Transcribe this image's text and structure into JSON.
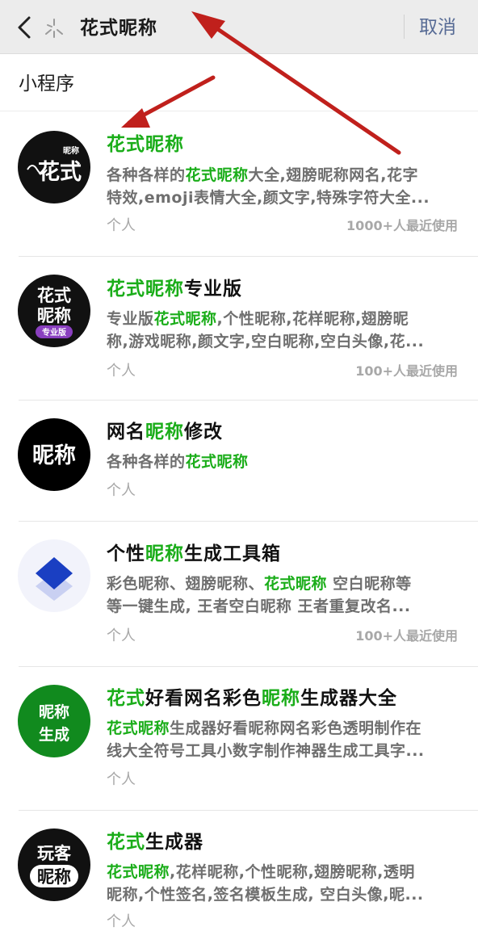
{
  "search": {
    "query": "花式昵称",
    "cancel_label": "取消"
  },
  "section_title": "小程序",
  "results": [
    {
      "title": [
        {
          "t": "花式昵称",
          "hl": true
        }
      ],
      "desc_lines": [
        [
          {
            "t": "各种各样的",
            "hl": false
          },
          {
            "t": "花式昵称",
            "hl": true
          },
          {
            "t": "大全,翅膀昵称网名,花字",
            "hl": false
          }
        ],
        [
          {
            "t": "特效,emoji表情大全,颜文字,特殊字符大全...",
            "hl": false
          }
        ]
      ],
      "type": "个人",
      "usage": "1000+人最近使用",
      "icon": {
        "name": "huashi-logo-icon",
        "text_main": "花式",
        "text_small": "昵称",
        "bg": "#111111"
      }
    },
    {
      "title": [
        {
          "t": "花式昵称",
          "hl": true
        },
        {
          "t": "专业版",
          "hl": false
        }
      ],
      "desc_lines": [
        [
          {
            "t": "专业版",
            "hl": false
          },
          {
            "t": "花式昵称",
            "hl": true
          },
          {
            "t": ",个性昵称,花样昵称,翅膀昵",
            "hl": false
          }
        ],
        [
          {
            "t": "称,游戏昵称,颜文字,空白昵称,空白头像,花...",
            "hl": false
          }
        ]
      ],
      "type": "个人",
      "usage": "100+人最近使用",
      "icon": {
        "name": "huashi-pro-logo-icon",
        "text_top": "花式",
        "text_mid": "昵称",
        "text_badge": "专业版",
        "bg": "#111111",
        "badge_color": "#8a3fbf"
      }
    },
    {
      "title": [
        {
          "t": "网名",
          "hl": false
        },
        {
          "t": "昵称",
          "hl": true
        },
        {
          "t": "修改",
          "hl": false
        }
      ],
      "desc_lines": [
        [
          {
            "t": "各种各样的",
            "hl": false
          },
          {
            "t": "花式昵称",
            "hl": true
          }
        ]
      ],
      "type": "个人",
      "usage": "",
      "icon": {
        "name": "nicheng-logo-icon",
        "text_main": "昵称",
        "bg": "#000000"
      }
    },
    {
      "title": [
        {
          "t": "个性",
          "hl": false
        },
        {
          "t": "昵称",
          "hl": true
        },
        {
          "t": "生成工具箱",
          "hl": false
        }
      ],
      "desc_lines": [
        [
          {
            "t": "彩色昵称、翅膀昵称、",
            "hl": false
          },
          {
            "t": "花式昵称",
            "hl": true
          },
          {
            "t": " 空白昵称等",
            "hl": false
          }
        ],
        [
          {
            "t": "等一键生成, 王者空白昵称 王者重复改名...",
            "hl": false
          }
        ]
      ],
      "type": "个人",
      "usage": "100+人最近使用",
      "icon": {
        "name": "stacked-diamond-logo-icon",
        "bg": "#f2f3fb",
        "color": "#1a3fc2"
      }
    },
    {
      "title": [
        {
          "t": "花式",
          "hl": true
        },
        {
          "t": "好看网名彩色",
          "hl": false
        },
        {
          "t": "昵称",
          "hl": true
        },
        {
          "t": "生成器大全",
          "hl": false
        }
      ],
      "desc_lines": [
        [
          {
            "t": "花式昵称",
            "hl": true
          },
          {
            "t": "生成器好看昵称网名彩色透明制作在",
            "hl": false
          }
        ],
        [
          {
            "t": "线大全符号工具小数字制作神器生成工具字...",
            "hl": false
          }
        ]
      ],
      "type": "个人",
      "usage": "",
      "icon": {
        "name": "nicheng-shengcheng-logo-icon",
        "text_top": "昵称",
        "text_bottom": "生成",
        "bg": "#118a1e"
      }
    },
    {
      "title": [
        {
          "t": "花式",
          "hl": true
        },
        {
          "t": "生成器",
          "hl": false
        }
      ],
      "desc_lines": [
        [
          {
            "t": "花式昵称",
            "hl": true
          },
          {
            "t": ",花样昵称,个性昵称,翅膀昵称,透明",
            "hl": false
          }
        ],
        [
          {
            "t": "昵称,个性签名,签名模板生成, 空白头像,昵...",
            "hl": false
          }
        ]
      ],
      "type": "个人",
      "usage": "",
      "icon": {
        "name": "wanke-logo-icon",
        "text_top": "玩客",
        "text_bottom": "昵称",
        "bg": "#111111"
      }
    }
  ],
  "colors": {
    "highlight": "#1aad19",
    "link": "#576b95",
    "annotation_arrow": "#c0201c"
  }
}
